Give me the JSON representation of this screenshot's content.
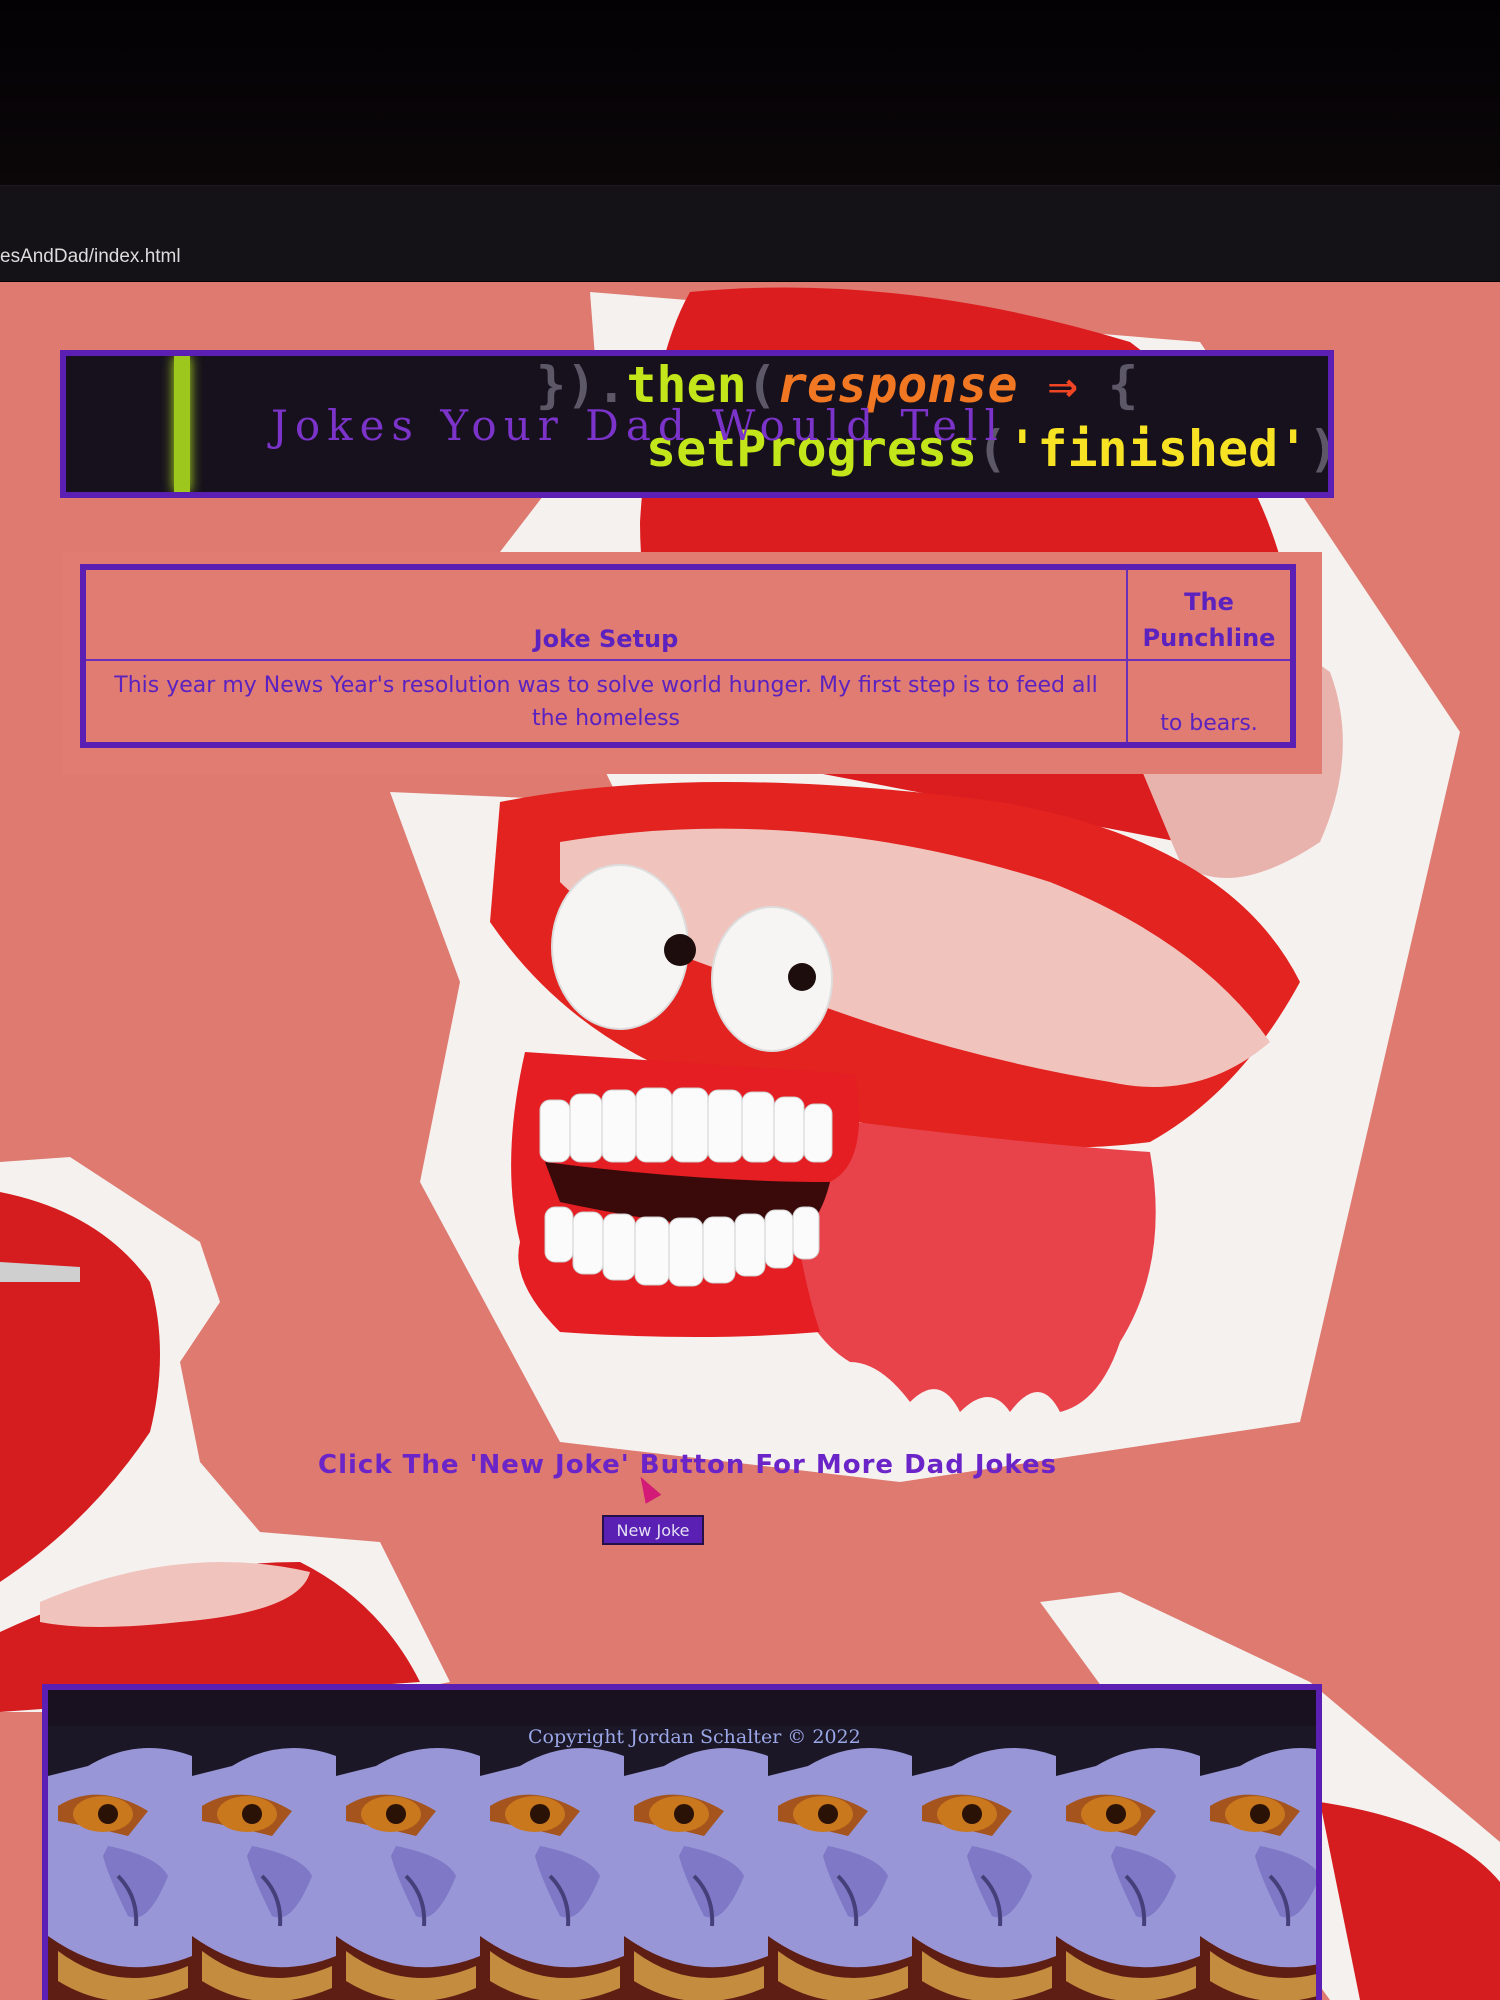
{
  "browser": {
    "url_fragment": "esAndDad/index.html"
  },
  "banner": {
    "code_line_1": {
      "dim_prefix": "}).",
      "then": "then",
      "paren": "(",
      "param": "response",
      "arrow": " ⇒ ",
      "brace": "{"
    },
    "code_line_2": {
      "fn": "setProgress",
      "open": "(",
      "arg": "'finished'",
      "close": ");"
    },
    "title": "Jokes Your Dad Would Tell"
  },
  "joke_table": {
    "header_setup": "Joke Setup",
    "header_punchline": "The Punchline",
    "setup": "This year my News Year's resolution was to solve world hunger. My first step is to feed all the homeless",
    "punchline": "to bears."
  },
  "prompt": "Click The 'New Joke' Button For More Dad Jokes",
  "new_joke_button": "New Joke",
  "footer": {
    "copyright": "Copyright Jordan Schalter © 2022"
  },
  "colors": {
    "page_bg": "#de7a70",
    "accent_purple": "#5b1fb4",
    "text_purple": "#6a24c7"
  },
  "icons": [
    "pointer-cursor-icon"
  ]
}
